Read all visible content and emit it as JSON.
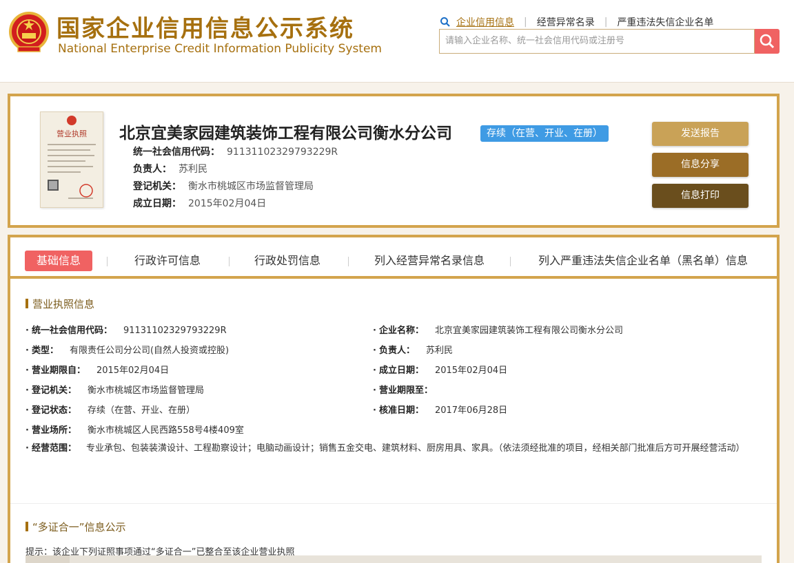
{
  "header": {
    "title_cn": "国家企业信用信息公示系统",
    "title_en": "National Enterprise Credit Information Publicity System",
    "nav": [
      {
        "label": "企业信用信息"
      },
      {
        "label": "经营异常名录"
      },
      {
        "label": "严重违法失信企业名单"
      }
    ],
    "search_placeholder": "请输入企业名称、统一社会信用代码或注册号"
  },
  "company": {
    "name": "北京宜美家园建筑装饰工程有限公司衡水分公司",
    "status_badge": "存续（在营、开业、在册）",
    "credit_code_label": "统一社会信用代码：",
    "credit_code": "91131102329793229R",
    "principal_label": "负责人：",
    "principal": "苏利民",
    "authority_label": "登记机关：",
    "authority": "衡水市桃城区市场监督管理局",
    "founded_label": "成立日期：",
    "founded": "2015年02月04日",
    "license_title": "营业执照"
  },
  "actions": {
    "send": "发送报告",
    "share": "信息分享",
    "print": "信息打印"
  },
  "tabs": [
    {
      "label": "基础信息"
    },
    {
      "label": "行政许可信息"
    },
    {
      "label": "行政处罚信息"
    },
    {
      "label": "列入经营异常名录信息"
    },
    {
      "label": "列入严重违法失信企业名单（黑名单）信息"
    }
  ],
  "license_section": {
    "title": "营业执照信息",
    "left": [
      {
        "label": "统一社会信用代码：",
        "value": "91131102329793229R"
      },
      {
        "label": "类型：",
        "value": "有限责任公司分公司(自然人投资或控股)"
      },
      {
        "label": "营业期限自：",
        "value": "2015年02月04日"
      },
      {
        "label": "登记机关：",
        "value": "衡水市桃城区市场监督管理局"
      },
      {
        "label": "登记状态：",
        "value": "存续（在营、开业、在册）"
      },
      {
        "label": "营业场所：",
        "value": "衡水市桃城区人民西路558号4楼409室"
      }
    ],
    "right": [
      {
        "label": "企业名称：",
        "value": "北京宜美家园建筑装饰工程有限公司衡水分公司"
      },
      {
        "label": "负责人：",
        "value": "苏利民"
      },
      {
        "label": "成立日期：",
        "value": "2015年02月04日"
      },
      {
        "label": "营业期限至：",
        "value": ""
      },
      {
        "label": "核准日期：",
        "value": "2017年06月28日"
      }
    ],
    "scope_label": "经营范围：",
    "scope_value": "专业承包、包装装潢设计、工程勘察设计；电脑动画设计；销售五金交电、建筑材料、厨房用具、家具。（依法须经批准的项目，经相关部门批准后方可开展经营活动）"
  },
  "multi_cert": {
    "title": "“多证合一”信息公示",
    "hint": "提示：该企业下列证照事项通过“多证合一”已整合至该企业营业执照"
  },
  "colors": {
    "brand_gold": "#a6700f",
    "border_gold": "#d3a44d",
    "active_tab": "#f06262",
    "status_blue": "#3f9be4"
  }
}
